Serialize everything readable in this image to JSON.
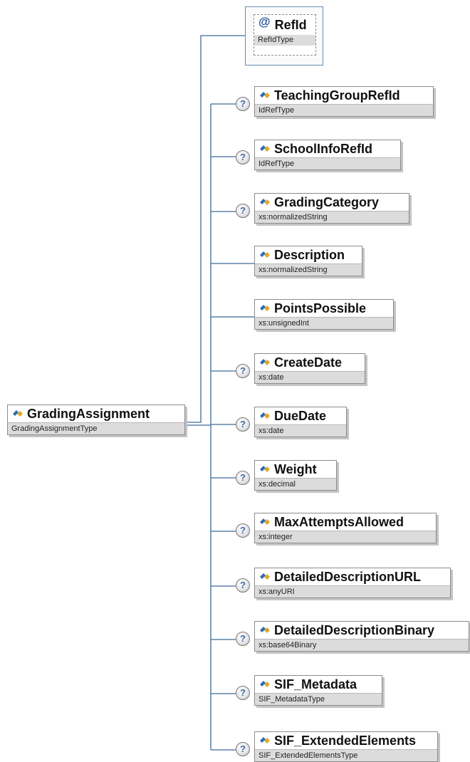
{
  "root": {
    "name": "GradingAssignment",
    "type": "GradingAssignmentType"
  },
  "attribute": {
    "symbol": "@",
    "name": "RefId",
    "type": "RefIdType"
  },
  "children": [
    {
      "name": "TeachingGroupRefId",
      "type": "IdRefType",
      "optional": true
    },
    {
      "name": "SchoolInfoRefId",
      "type": "IdRefType",
      "optional": true
    },
    {
      "name": "GradingCategory",
      "type": "xs:normalizedString",
      "optional": true
    },
    {
      "name": "Description",
      "type": "xs:normalizedString",
      "optional": false
    },
    {
      "name": "PointsPossible",
      "type": "xs:unsignedInt",
      "optional": false
    },
    {
      "name": "CreateDate",
      "type": "xs:date",
      "optional": true
    },
    {
      "name": "DueDate",
      "type": "xs:date",
      "optional": true
    },
    {
      "name": "Weight",
      "type": "xs:decimal",
      "optional": true
    },
    {
      "name": "MaxAttemptsAllowed",
      "type": "xs:integer",
      "optional": true
    },
    {
      "name": "DetailedDescriptionURL",
      "type": "xs:anyURI",
      "optional": true
    },
    {
      "name": "DetailedDescriptionBinary",
      "type": "xs:base64Binary",
      "optional": true
    },
    {
      "name": "SIF_Metadata",
      "type": "SIF_MetadataType",
      "optional": true
    },
    {
      "name": "SIF_ExtendedElements",
      "type": "SIF_ExtendedElementsType",
      "optional": true
    }
  ],
  "optional_marker": "?",
  "colors": {
    "connector": "#3c6a96",
    "icon_blue": "#2f6bb3",
    "icon_gold": "#e0a82a",
    "type_bar": "#dcdcdc"
  }
}
